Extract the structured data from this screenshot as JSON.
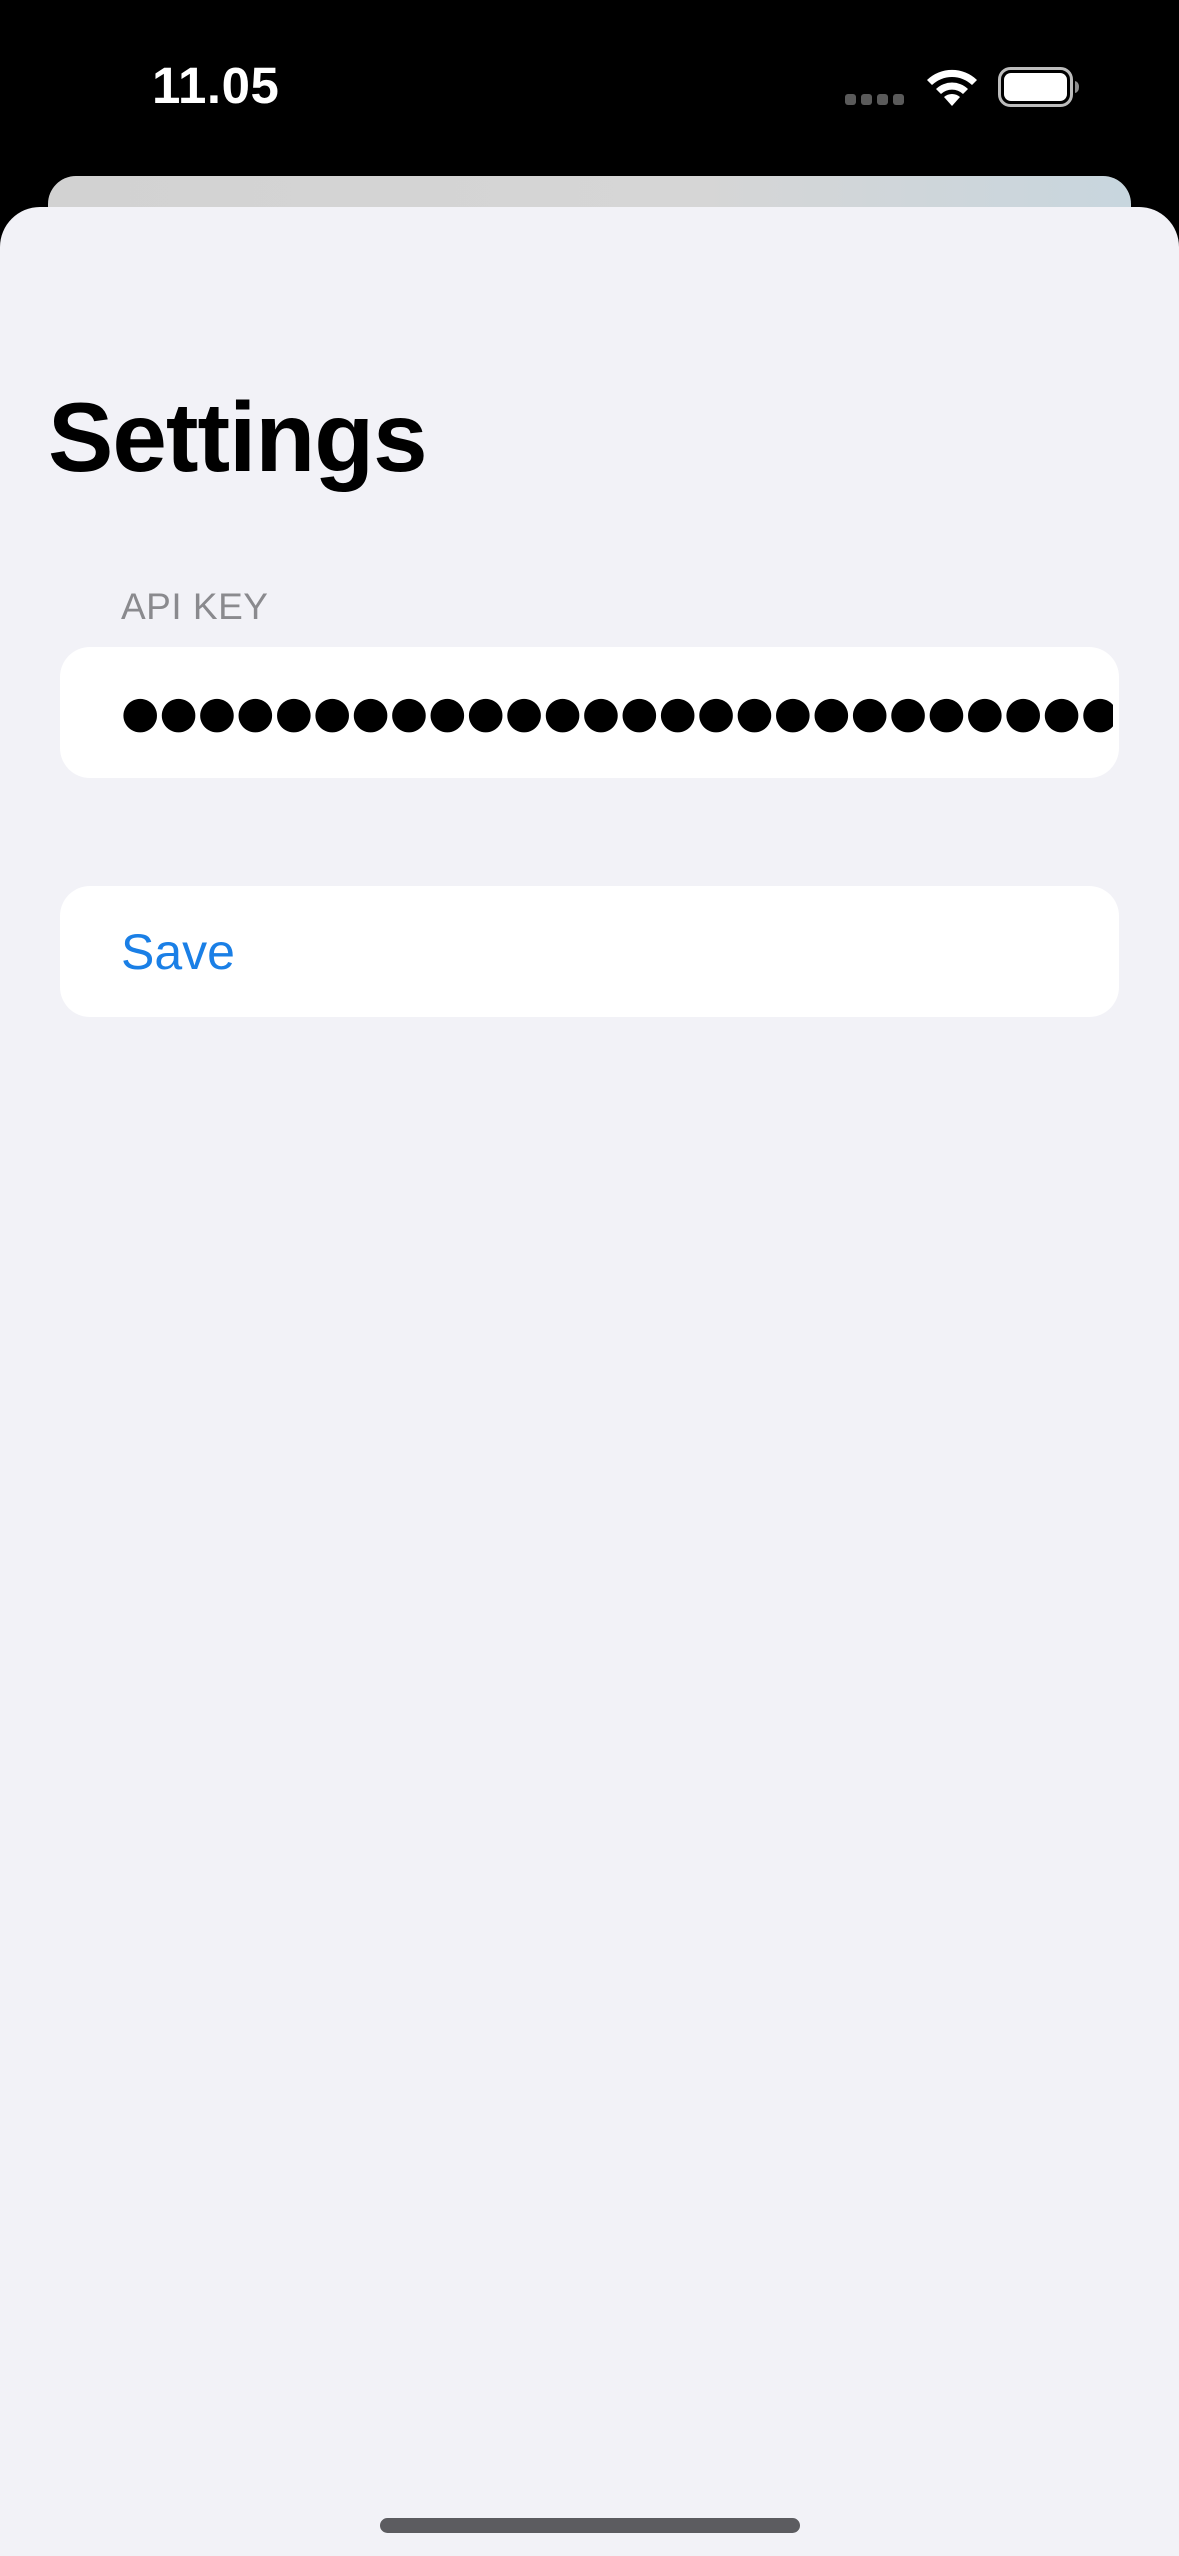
{
  "status_bar": {
    "time": "11.05",
    "icons": [
      "signal-icon",
      "wifi-icon",
      "battery-icon"
    ]
  },
  "page": {
    "title": "Settings"
  },
  "api_key_section": {
    "header": "API KEY",
    "value": "●●●●●●●●●●●●●●●●●●●●●●●●●●●●●●…"
  },
  "actions": {
    "save_label": "Save"
  },
  "colors": {
    "accent": "#1a7fe6",
    "background": "#f2f2f7",
    "group_background": "#ffffff",
    "secondary_text": "#8a8a8e"
  }
}
